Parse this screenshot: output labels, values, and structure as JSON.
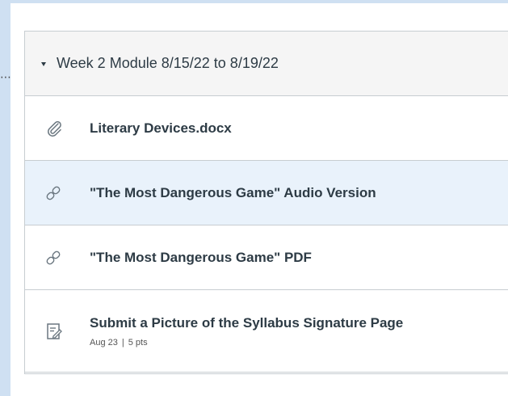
{
  "overflow_indicator": "⋯",
  "module": {
    "title": "Week 2 Module 8/15/22 to 8/19/22",
    "items": [
      {
        "icon": "attachment-icon",
        "title": "Literary Devices.docx"
      },
      {
        "icon": "link-icon",
        "title": "\"The Most Dangerous Game\" Audio Version"
      },
      {
        "icon": "link-icon",
        "title": "\"The Most Dangerous Game\" PDF"
      },
      {
        "icon": "assignment-icon",
        "title": "Submit a Picture of the Syllabus Signature Page",
        "due": "Aug 23",
        "separator": "|",
        "points": "5 pts"
      }
    ]
  }
}
